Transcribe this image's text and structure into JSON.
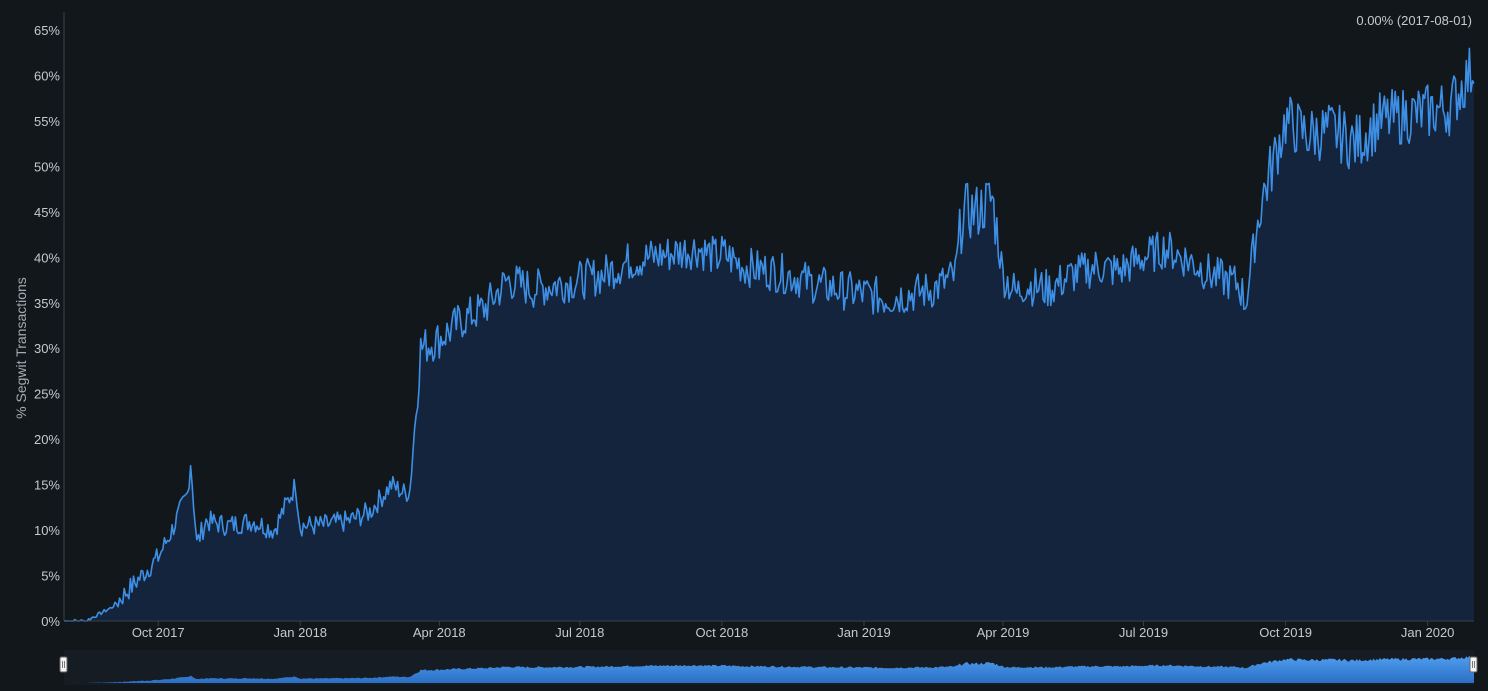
{
  "chart_data": {
    "type": "area",
    "ylabel": "% Segwit Transactions",
    "info_label": "0.00% (2017-08-01)",
    "x_start": "2017-08-01",
    "x_end": "2020-01-31",
    "ylim": [
      0,
      65
    ],
    "y_ticks": [
      0,
      5,
      10,
      15,
      20,
      25,
      30,
      35,
      40,
      45,
      50,
      55,
      60,
      65
    ],
    "y_tick_suffix": "%",
    "x_ticks": [
      {
        "date": "2017-10-01",
        "label": "Oct 2017"
      },
      {
        "date": "2018-01-01",
        "label": "Jan 2018"
      },
      {
        "date": "2018-04-01",
        "label": "Apr 2018"
      },
      {
        "date": "2018-07-01",
        "label": "Jul 2018"
      },
      {
        "date": "2018-10-01",
        "label": "Oct 2018"
      },
      {
        "date": "2019-01-01",
        "label": "Jan 2019"
      },
      {
        "date": "2019-04-01",
        "label": "Apr 2019"
      },
      {
        "date": "2019-07-01",
        "label": "Jul 2019"
      },
      {
        "date": "2019-10-01",
        "label": "Oct 2019"
      },
      {
        "date": "2020-01-01",
        "label": "Jan 2020"
      }
    ],
    "line_color": "#3d8fe6",
    "area_color": "#13243c",
    "navigator_color": "#4f9df0",
    "grid": false,
    "legend": "none",
    "series": [
      {
        "x": [
          "2017-08-01",
          "2017-08-15",
          "2017-09-01",
          "2017-09-15",
          "2017-10-01",
          "2017-10-10",
          "2017-10-20",
          "2017-10-22",
          "2017-10-26",
          "2017-11-01",
          "2017-11-15",
          "2017-12-01",
          "2017-12-15",
          "2017-12-29",
          "2018-01-01",
          "2018-01-15",
          "2018-02-01",
          "2018-02-15",
          "2018-03-01",
          "2018-03-10",
          "2018-03-13",
          "2018-03-20",
          "2018-04-01",
          "2018-04-15",
          "2018-05-01",
          "2018-05-15",
          "2018-06-01",
          "2018-06-15",
          "2018-07-01",
          "2018-07-15",
          "2018-08-01",
          "2018-08-15",
          "2018-09-01",
          "2018-09-15",
          "2018-09-28",
          "2018-10-01",
          "2018-10-15",
          "2018-11-01",
          "2018-11-15",
          "2018-12-01",
          "2018-12-15",
          "2019-01-01",
          "2019-01-15",
          "2019-02-01",
          "2019-02-15",
          "2019-03-01",
          "2019-03-06",
          "2019-03-15",
          "2019-03-25",
          "2019-04-01",
          "2019-04-10",
          "2019-04-15",
          "2019-05-01",
          "2019-05-15",
          "2019-06-01",
          "2019-06-15",
          "2019-07-01",
          "2019-07-15",
          "2019-08-01",
          "2019-08-15",
          "2019-09-01",
          "2019-09-05",
          "2019-09-15",
          "2019-10-01",
          "2019-10-15",
          "2019-11-01",
          "2019-11-15",
          "2019-12-01",
          "2019-12-15",
          "2020-01-01",
          "2020-01-15",
          "2020-01-31"
        ],
        "values": [
          0.0,
          0.0,
          1.5,
          4.0,
          7.0,
          10.0,
          14.0,
          17.5,
          8.5,
          11.0,
          10.5,
          11.0,
          10.0,
          15.0,
          10.5,
          10.5,
          11.0,
          12.0,
          15.0,
          14.0,
          14.5,
          30.0,
          31.0,
          33.0,
          34.5,
          37.5,
          36.5,
          37.0,
          37.5,
          38.0,
          39.5,
          40.0,
          40.5,
          41.0,
          40.0,
          40.5,
          39.0,
          38.5,
          38.0,
          37.0,
          36.5,
          36.0,
          35.5,
          36.0,
          36.5,
          38.0,
          45.0,
          45.0,
          46.5,
          38.0,
          36.0,
          37.0,
          36.5,
          38.0,
          39.0,
          38.5,
          40.0,
          41.0,
          39.5,
          38.0,
          37.0,
          35.0,
          46.0,
          55.0,
          53.5,
          54.0,
          52.5,
          55.0,
          55.5,
          56.0,
          56.5,
          61.0
        ]
      }
    ]
  }
}
